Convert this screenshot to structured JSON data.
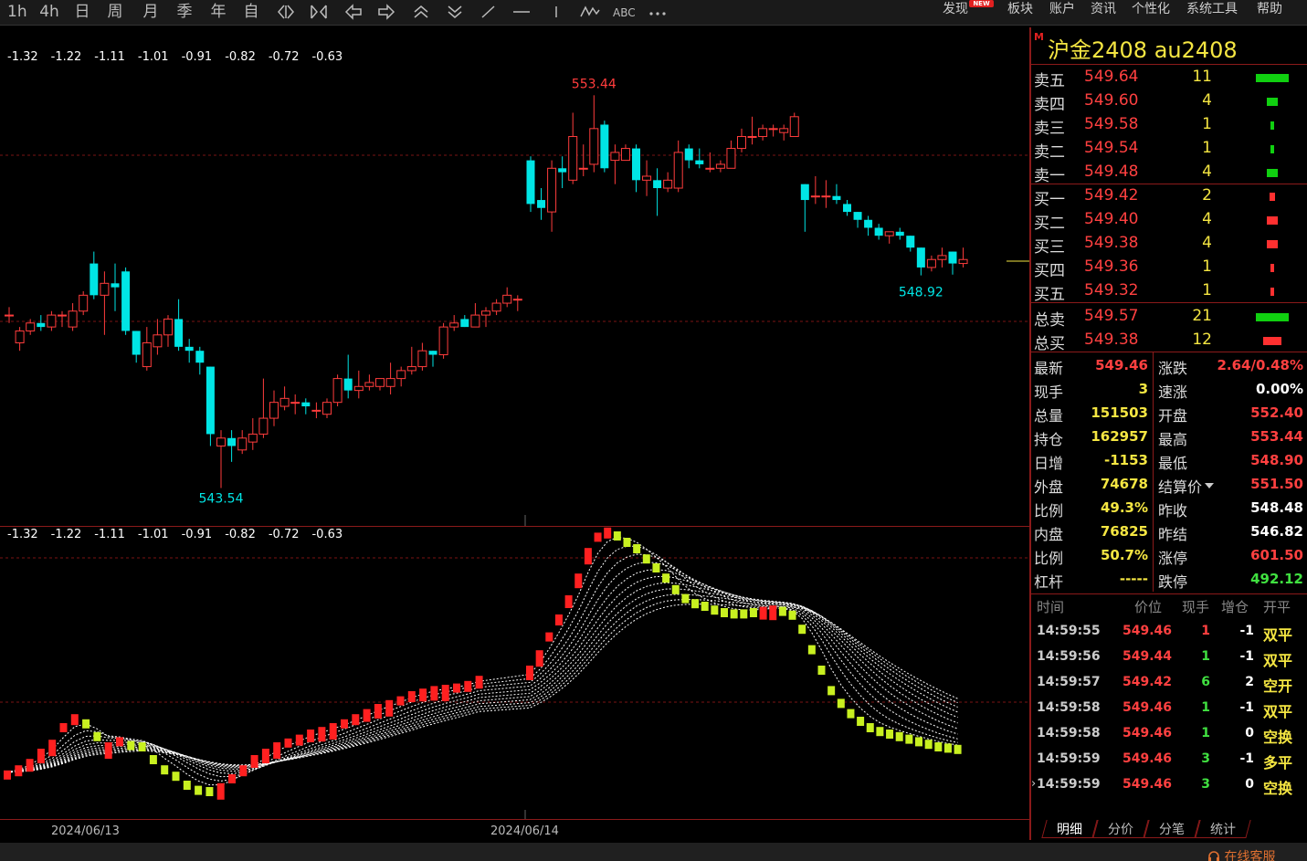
{
  "toolbar": {
    "periods": [
      "1h",
      "4h",
      "日",
      "周",
      "月",
      "季",
      "年",
      "自"
    ],
    "menu": [
      "发现",
      "板块",
      "账户",
      "资讯",
      "个性化",
      "系统工具",
      "帮助"
    ],
    "new_badge": "NEW"
  },
  "chart": {
    "scale_main": [
      "-1.32",
      "-1.22",
      "-1.11",
      "-1.01",
      "-0.91",
      "-0.82",
      "-0.72",
      "-0.63"
    ],
    "scale_sub": [
      "-1.32",
      "-1.22",
      "-1.11",
      "-1.01",
      "-0.91",
      "-0.82",
      "-0.72",
      "-0.63"
    ],
    "high_label": "553.44",
    "low_label": "543.54",
    "last_low_label": "548.92",
    "dates": [
      "2024/06/13",
      "2024/06/14"
    ],
    "colors": {
      "up": "#ff3c3c",
      "down": "#00e5e5",
      "ribbon_up": "#ff2020",
      "ribbon_down": "#c8f020"
    }
  },
  "chart_data": {
    "type": "candlestick",
    "title": "",
    "xlabel": "",
    "ylabel": "",
    "categories": [
      "2024/06/13",
      "2024/06/14"
    ],
    "ylim": [
      543.0,
      554.0
    ],
    "highest": 553.44,
    "lowest": 543.54,
    "last_low": 548.92,
    "candles": [
      [
        547.9,
        547.9,
        548.1,
        547.7
      ],
      [
        547.2,
        547.5,
        547.6,
        547.0
      ],
      [
        547.5,
        547.7,
        547.8,
        547.4
      ],
      [
        547.7,
        547.6,
        547.9,
        547.5
      ],
      [
        547.6,
        547.9,
        548.0,
        547.5
      ],
      [
        547.9,
        547.9,
        548.0,
        547.6
      ],
      [
        547.6,
        548.0,
        548.2,
        547.5
      ],
      [
        548.0,
        548.4,
        548.5,
        547.9
      ],
      [
        549.2,
        548.4,
        549.5,
        548.3
      ],
      [
        548.4,
        548.7,
        549.0,
        547.4
      ],
      [
        548.7,
        548.6,
        549.2,
        548.0
      ],
      [
        549.0,
        547.5,
        549.1,
        547.4
      ],
      [
        547.5,
        546.9,
        547.5,
        546.7
      ],
      [
        546.6,
        547.2,
        547.6,
        546.5
      ],
      [
        547.1,
        547.4,
        547.8,
        546.9
      ],
      [
        547.4,
        547.8,
        547.9,
        547.1
      ],
      [
        547.8,
        547.1,
        548.3,
        547.0
      ],
      [
        547.1,
        547.0,
        547.3,
        546.7
      ],
      [
        547.0,
        546.7,
        547.1,
        546.4
      ],
      [
        546.6,
        544.9,
        546.6,
        544.6
      ],
      [
        544.6,
        544.8,
        545.0,
        543.54
      ],
      [
        544.8,
        544.6,
        545.0,
        544.2
      ],
      [
        544.5,
        544.8,
        545.0,
        544.4
      ],
      [
        544.7,
        544.9,
        545.3,
        544.5
      ],
      [
        544.9,
        545.3,
        546.3,
        544.8
      ],
      [
        545.3,
        545.7,
        546.0,
        545.1
      ],
      [
        545.6,
        545.8,
        546.1,
        545.5
      ],
      [
        545.7,
        545.7,
        545.9,
        545.4
      ],
      [
        545.7,
        545.6,
        545.8,
        545.4
      ],
      [
        545.5,
        545.5,
        545.7,
        545.3
      ],
      [
        545.4,
        545.7,
        545.8,
        545.3
      ],
      [
        545.7,
        546.3,
        546.4,
        545.6
      ],
      [
        546.3,
        546.0,
        546.9,
        545.8
      ],
      [
        546.0,
        546.1,
        546.5,
        545.8
      ],
      [
        546.1,
        546.2,
        546.4,
        546.0
      ],
      [
        546.1,
        546.3,
        546.3,
        546.0
      ],
      [
        546.1,
        546.3,
        546.7,
        545.9
      ],
      [
        546.3,
        546.5,
        546.6,
        546.1
      ],
      [
        546.5,
        546.6,
        547.1,
        546.4
      ],
      [
        546.6,
        547.0,
        547.2,
        546.5
      ],
      [
        547.0,
        546.9,
        547.0,
        546.6
      ],
      [
        546.9,
        547.6,
        547.7,
        546.8
      ],
      [
        547.6,
        547.7,
        547.9,
        547.5
      ],
      [
        547.8,
        547.6,
        547.9,
        547.6
      ],
      [
        547.6,
        547.9,
        548.2,
        547.7
      ],
      [
        547.9,
        548.0,
        548.1,
        547.6
      ],
      [
        548.0,
        548.2,
        548.3,
        547.9
      ],
      [
        548.2,
        548.4,
        548.6,
        548.1
      ],
      [
        548.3,
        548.3,
        548.4,
        548.0
      ],
      [
        551.8,
        550.7,
        551.9,
        550.5
      ],
      [
        550.8,
        550.6,
        551.1,
        550.3
      ],
      [
        550.5,
        551.6,
        551.8,
        550.0
      ],
      [
        551.6,
        551.5,
        551.9,
        551.1
      ],
      [
        551.3,
        552.4,
        553.0,
        551.2
      ],
      [
        551.6,
        551.6,
        552.2,
        551.4
      ],
      [
        551.7,
        552.6,
        553.44,
        551.5
      ],
      [
        552.7,
        551.6,
        552.8,
        551.5
      ],
      [
        551.8,
        552.0,
        552.2,
        551.2
      ],
      [
        551.8,
        552.1,
        552.2,
        551.8
      ],
      [
        552.1,
        551.3,
        552.2,
        551.0
      ],
      [
        551.3,
        551.4,
        551.8,
        550.9
      ],
      [
        551.3,
        551.1,
        551.6,
        550.4
      ],
      [
        551.1,
        551.3,
        551.5,
        551.0
      ],
      [
        551.1,
        552.0,
        552.3,
        551.0
      ],
      [
        552.1,
        551.8,
        552.2,
        551.6
      ],
      [
        551.8,
        551.7,
        552.1,
        551.6
      ],
      [
        551.6,
        551.6,
        552.0,
        551.5
      ],
      [
        551.6,
        551.7,
        551.8,
        551.5
      ],
      [
        551.6,
        552.1,
        552.3,
        551.6
      ],
      [
        552.1,
        552.4,
        552.6,
        552.0
      ],
      [
        552.4,
        552.4,
        552.9,
        552.2
      ],
      [
        552.4,
        552.6,
        552.7,
        552.3
      ],
      [
        552.6,
        552.6,
        552.7,
        552.4
      ],
      [
        552.5,
        552.6,
        552.7,
        552.3
      ],
      [
        552.4,
        552.9,
        553.0,
        552.4
      ],
      [
        551.2,
        550.8,
        551.2,
        550.0
      ],
      [
        550.9,
        550.9,
        551.4,
        550.7
      ],
      [
        550.9,
        550.9,
        551.3,
        550.6
      ],
      [
        550.9,
        550.8,
        551.2,
        550.7
      ],
      [
        550.7,
        550.5,
        550.8,
        550.4
      ],
      [
        550.5,
        550.3,
        550.5,
        550.1
      ],
      [
        550.3,
        550.1,
        550.4,
        549.9
      ],
      [
        550.1,
        549.9,
        550.2,
        549.8
      ],
      [
        549.9,
        550.0,
        550.0,
        549.7
      ],
      [
        550.0,
        549.9,
        550.1,
        549.8
      ],
      [
        549.9,
        549.6,
        549.9,
        549.5
      ],
      [
        549.6,
        549.1,
        549.6,
        548.9
      ],
      [
        549.1,
        549.3,
        549.4,
        549.0
      ],
      [
        549.3,
        549.4,
        549.6,
        549.1
      ],
      [
        549.5,
        549.2,
        549.5,
        548.92
      ],
      [
        549.2,
        549.3,
        549.6,
        549.1
      ]
    ],
    "ribbon_signal": [
      [
        0.18,
        1
      ],
      [
        0.22,
        1
      ],
      [
        0.27,
        1
      ],
      [
        0.35,
        1
      ],
      [
        0.42,
        1
      ],
      [
        0.55,
        1
      ],
      [
        0.62,
        1
      ],
      [
        0.58,
        0
      ],
      [
        0.48,
        0
      ],
      [
        0.4,
        1
      ],
      [
        0.44,
        1
      ],
      [
        0.41,
        0
      ],
      [
        0.4,
        0
      ],
      [
        0.3,
        0
      ],
      [
        0.22,
        0
      ],
      [
        0.17,
        0
      ],
      [
        0.1,
        0
      ],
      [
        0.06,
        0
      ],
      [
        0.05,
        0
      ],
      [
        0.08,
        1
      ],
      [
        0.15,
        1
      ],
      [
        0.22,
        1
      ],
      [
        0.3,
        1
      ],
      [
        0.35,
        1
      ],
      [
        0.4,
        1
      ],
      [
        0.43,
        1
      ],
      [
        0.46,
        1
      ],
      [
        0.5,
        1
      ],
      [
        0.52,
        1
      ],
      [
        0.55,
        1
      ],
      [
        0.58,
        1
      ],
      [
        0.62,
        1
      ],
      [
        0.66,
        1
      ],
      [
        0.7,
        1
      ],
      [
        0.73,
        1
      ],
      [
        0.76,
        1
      ],
      [
        0.8,
        1
      ],
      [
        0.82,
        1
      ],
      [
        0.84,
        1
      ],
      [
        0.85,
        1
      ],
      [
        0.86,
        1
      ],
      [
        0.88,
        1
      ],
      [
        0.92,
        1
      ],
      [
        1.0,
        1
      ],
      [
        1.12,
        1
      ],
      [
        1.26,
        1
      ],
      [
        1.4,
        1
      ],
      [
        1.55,
        1
      ],
      [
        1.72,
        1
      ],
      [
        1.92,
        1
      ],
      [
        2.04,
        1
      ],
      [
        2.08,
        1
      ],
      [
        2.05,
        0
      ],
      [
        2.0,
        0
      ],
      [
        1.95,
        0
      ],
      [
        1.87,
        0
      ],
      [
        1.8,
        0
      ],
      [
        1.72,
        0
      ],
      [
        1.63,
        0
      ],
      [
        1.56,
        0
      ],
      [
        1.52,
        0
      ],
      [
        1.5,
        0
      ],
      [
        1.47,
        0
      ],
      [
        1.45,
        0
      ],
      [
        1.44,
        0
      ],
      [
        1.44,
        0
      ],
      [
        1.45,
        0
      ],
      [
        1.46,
        1
      ],
      [
        1.47,
        1
      ],
      [
        1.46,
        0
      ],
      [
        1.43,
        0
      ],
      [
        1.32,
        0
      ],
      [
        1.16,
        0
      ],
      [
        1.0,
        0
      ],
      [
        0.84,
        0
      ],
      [
        0.74,
        0
      ],
      [
        0.66,
        0
      ],
      [
        0.6,
        0
      ],
      [
        0.55,
        0
      ],
      [
        0.52,
        0
      ],
      [
        0.5,
        0
      ],
      [
        0.48,
        0
      ],
      [
        0.46,
        0
      ],
      [
        0.44,
        0
      ],
      [
        0.42,
        0
      ],
      [
        0.4,
        0
      ],
      [
        0.39,
        0
      ],
      [
        0.38,
        0
      ]
    ]
  },
  "quote": {
    "title": "沪金2408  au2408",
    "m_mark": "M",
    "asks": [
      {
        "label": "卖五",
        "price": "549.64",
        "vol": "11",
        "level": 11
      },
      {
        "label": "卖四",
        "price": "549.60",
        "vol": "4",
        "level": 4
      },
      {
        "label": "卖三",
        "price": "549.58",
        "vol": "1",
        "level": 1
      },
      {
        "label": "卖二",
        "price": "549.54",
        "vol": "1",
        "level": 1
      },
      {
        "label": "卖一",
        "price": "549.48",
        "vol": "4",
        "level": 4
      }
    ],
    "bids": [
      {
        "label": "买一",
        "price": "549.42",
        "vol": "2",
        "level": 2
      },
      {
        "label": "买二",
        "price": "549.40",
        "vol": "4",
        "level": 4
      },
      {
        "label": "买三",
        "price": "549.38",
        "vol": "4",
        "level": 4
      },
      {
        "label": "买四",
        "price": "549.36",
        "vol": "1",
        "level": 1
      },
      {
        "label": "买五",
        "price": "549.32",
        "vol": "1",
        "level": 1
      }
    ],
    "totals": [
      {
        "label": "总卖",
        "price": "549.57",
        "vol": "21",
        "level": 21
      },
      {
        "label": "总买",
        "price": "549.38",
        "vol": "12",
        "level": 12
      }
    ],
    "stats_left": [
      {
        "label": "最新",
        "value": "549.46",
        "color": "#ff4040"
      },
      {
        "label": "现手",
        "value": "3",
        "color": "#f5e642"
      },
      {
        "label": "总量",
        "value": "151503",
        "color": "#f5e642"
      },
      {
        "label": "持仓",
        "value": "162957",
        "color": "#f5e642"
      },
      {
        "label": "日增",
        "value": "-1153",
        "color": "#f5e642"
      },
      {
        "label": "外盘",
        "value": "74678",
        "color": "#f5e642"
      },
      {
        "label": "比例",
        "value": "49.3%",
        "color": "#f5e642"
      },
      {
        "label": "内盘",
        "value": "76825",
        "color": "#f5e642"
      },
      {
        "label": "比例",
        "value": "50.7%",
        "color": "#f5e642"
      },
      {
        "label": "杠杆",
        "value": "-----",
        "color": "#f5e642"
      }
    ],
    "stats_right": [
      {
        "label": "涨跌",
        "value": "2.64/0.48%",
        "color": "#ff4040"
      },
      {
        "label": "速涨",
        "value": "0.00%",
        "color": "#ffffff"
      },
      {
        "label": "开盘",
        "value": "552.40",
        "color": "#ff4040"
      },
      {
        "label": "最高",
        "value": "553.44",
        "color": "#ff4040"
      },
      {
        "label": "最低",
        "value": "548.90",
        "color": "#ff4040"
      },
      {
        "label": "结算价",
        "value": "551.50",
        "color": "#ff4040"
      },
      {
        "label": "昨收",
        "value": "548.48",
        "color": "#ffffff"
      },
      {
        "label": "昨结",
        "value": "546.82",
        "color": "#ffffff"
      },
      {
        "label": "涨停",
        "value": "601.50",
        "color": "#ff4040"
      },
      {
        "label": "跌停",
        "value": "492.12",
        "color": "#40e040"
      }
    ],
    "tick_headers": {
      "time": "时间",
      "price": "价位",
      "vol": "现手",
      "oi": "增仓",
      "type": "开平"
    },
    "ticks": [
      {
        "time": "14:59:55",
        "price": "549.46",
        "vol": "1",
        "oi": "-1",
        "type": "双平",
        "vcolor": "#ff4040",
        "tcolor": "#f5e642"
      },
      {
        "time": "14:59:56",
        "price": "549.44",
        "vol": "1",
        "oi": "-1",
        "type": "双平",
        "vcolor": "#40e040",
        "tcolor": "#f5e642"
      },
      {
        "time": "14:59:57",
        "price": "549.42",
        "vol": "6",
        "oi": "2",
        "type": "空开",
        "vcolor": "#40e040",
        "tcolor": "#f5e642"
      },
      {
        "time": "14:59:58",
        "price": "549.46",
        "vol": "1",
        "oi": "-1",
        "type": "双平",
        "vcolor": "#40e040",
        "tcolor": "#f5e642"
      },
      {
        "time": "14:59:58",
        "price": "549.46",
        "vol": "1",
        "oi": "0",
        "type": "空换",
        "vcolor": "#40e040",
        "tcolor": "#f5e642"
      },
      {
        "time": "14:59:59",
        "price": "549.46",
        "vol": "3",
        "oi": "-1",
        "type": "多平",
        "vcolor": "#40e040",
        "tcolor": "#f5e642"
      },
      {
        "time": "14:59:59",
        "price": "549.46",
        "vol": "3",
        "oi": "0",
        "type": "空换",
        "vcolor": "#40e040",
        "tcolor": "#f5e642"
      }
    ],
    "tabs": [
      "明细",
      "分价",
      "分笔",
      "统计"
    ]
  },
  "status": {
    "service": "在线客服"
  }
}
